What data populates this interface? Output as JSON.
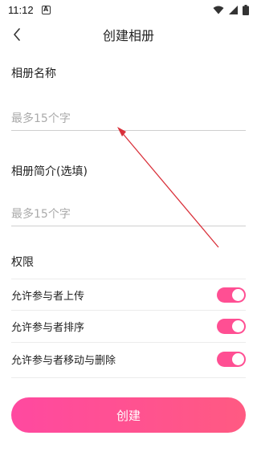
{
  "status_bar": {
    "time": "11:12",
    "notification_letter": "A"
  },
  "nav": {
    "title": "创建相册"
  },
  "form": {
    "name_label": "相册名称",
    "name_placeholder": "最多15个字",
    "intro_label": "相册简介(选填)",
    "intro_placeholder": "最多15个字"
  },
  "permissions": {
    "title": "权限",
    "items": [
      {
        "label": "允许参与者上传",
        "enabled": true
      },
      {
        "label": "允许参与者排序",
        "enabled": true
      },
      {
        "label": "允许参与者移动与删除",
        "enabled": true
      }
    ]
  },
  "create_button": {
    "label": "创建"
  },
  "colors": {
    "accent": "#ff4f93",
    "annotation_arrow": "#d9303a"
  }
}
